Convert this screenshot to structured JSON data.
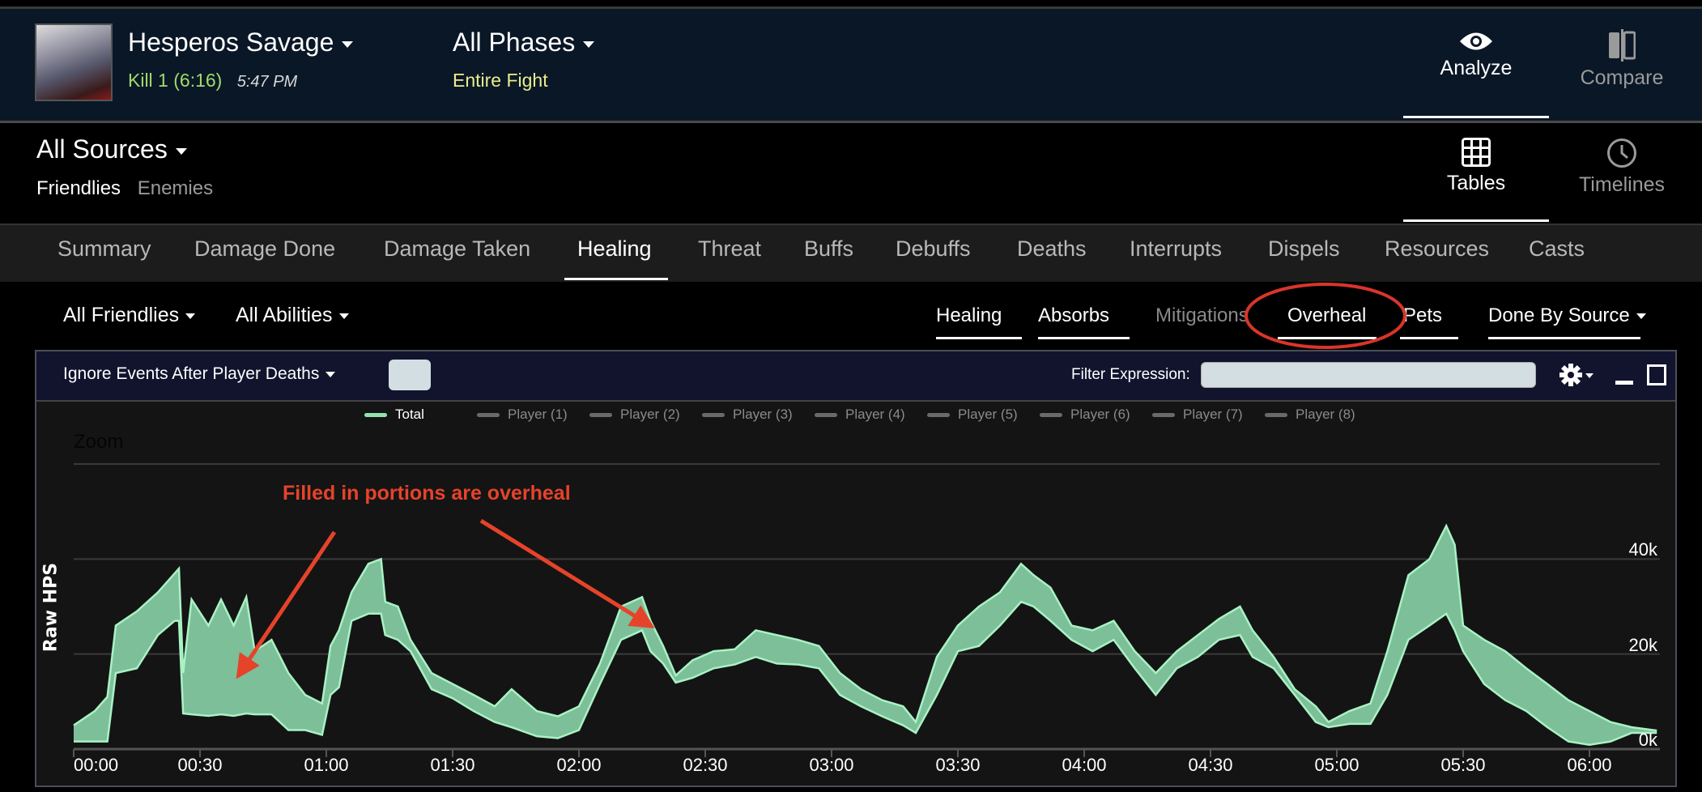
{
  "header": {
    "encounter_name": "Hesperos Savage",
    "kill_label": "Kill 1 (6:16)",
    "time": "5:47 PM",
    "phase_select": "All Phases",
    "phase_sub": "Entire Fight",
    "modes": [
      {
        "label": "Analyze",
        "icon": "eye-icon",
        "active": true
      },
      {
        "label": "Compare",
        "icon": "compare-icon",
        "active": false
      }
    ]
  },
  "sources": {
    "select": "All Sources",
    "filters": [
      "Friendlies",
      "Enemies"
    ],
    "views": [
      {
        "label": "Tables",
        "icon": "grid-icon",
        "active": true
      },
      {
        "label": "Timelines",
        "icon": "clock-icon",
        "active": false
      }
    ]
  },
  "tabs": [
    "Summary",
    "Damage Done",
    "Damage Taken",
    "Healing",
    "Threat",
    "Buffs",
    "Debuffs",
    "Deaths",
    "Interrupts",
    "Dispels",
    "Resources",
    "Casts"
  ],
  "active_tab": "Healing",
  "filters": {
    "friendlies": "All Friendlies",
    "abilities": "All Abilities",
    "subtabs": [
      "Healing",
      "Absorbs",
      "Mitigations",
      "Overheal",
      "Pets"
    ],
    "grouping": "Done By Source"
  },
  "panel": {
    "ignore_events": "Ignore Events After Player Deaths",
    "filter_label": "Filter Expression:",
    "filter_value": ""
  },
  "colors": {
    "accent_green": "#8fe3b0",
    "fill_green": "#7dbf98",
    "annotation_red": "#e5432a",
    "header_navy": "#0a1727"
  },
  "annotation": {
    "text": "Filled in portions are overheal"
  },
  "chart_data": {
    "type": "area",
    "zoom_label": "Zoom",
    "ylabel": "Raw HPS",
    "xlabel": "",
    "ylim": [
      0,
      60000
    ],
    "xlim": [
      "00:00",
      "06:16"
    ],
    "grid": true,
    "legend_position": "top",
    "legend": [
      "Total",
      "Player (1)",
      "Player (2)",
      "Player (3)",
      "Player (4)",
      "Player (5)",
      "Player (6)",
      "Player (7)",
      "Player (8)"
    ],
    "x_ticks": [
      "00:00",
      "00:30",
      "01:00",
      "01:30",
      "02:00",
      "02:30",
      "03:00",
      "03:30",
      "04:00",
      "04:30",
      "05:00",
      "05:30",
      "06:00"
    ],
    "y_ticks": [
      "0k",
      "20k",
      "40k"
    ],
    "x_seconds": [
      0,
      5,
      8,
      10,
      15,
      20,
      24,
      25,
      26,
      28,
      32,
      35,
      38,
      41,
      43,
      47,
      51,
      55,
      59,
      61,
      63,
      66,
      70,
      73,
      74,
      77,
      80,
      85,
      90,
      95,
      100,
      104,
      110,
      115,
      120,
      125,
      130,
      135,
      137,
      140,
      143,
      147,
      152,
      157,
      162,
      167,
      172,
      177,
      182,
      187,
      192,
      197,
      200,
      205,
      210,
      215,
      220,
      225,
      228,
      232,
      237,
      242,
      247,
      252,
      257,
      262,
      267,
      272,
      277,
      280,
      285,
      290,
      295,
      298,
      303,
      308,
      312,
      317,
      322,
      326,
      328,
      330,
      335,
      340,
      345,
      350,
      355,
      360,
      365,
      370,
      376
    ],
    "series": [
      {
        "name": "Total",
        "values": [
          5000,
          8000,
          11000,
          26000,
          29000,
          33000,
          37000,
          38000,
          16000,
          31500,
          26000,
          31500,
          26000,
          32000,
          20600,
          23000,
          16000,
          11400,
          9600,
          21700,
          25000,
          33000,
          39000,
          40000,
          31000,
          30000,
          23000,
          16000,
          13700,
          11400,
          9000,
          12600,
          8000,
          6900,
          9000,
          18000,
          30000,
          32000,
          27000,
          21700,
          15500,
          18700,
          20600,
          21000,
          25000,
          24000,
          23000,
          21700,
          16000,
          12600,
          10300,
          9000,
          5700,
          19400,
          26000,
          30000,
          33000,
          39000,
          36600,
          34000,
          26000,
          25000,
          27000,
          20600,
          16000,
          20600,
          24000,
          27400,
          30000,
          25000,
          19400,
          12600,
          9000,
          5700,
          8000,
          9600,
          20600,
          36600,
          40000,
          47000,
          43000,
          26000,
          23000,
          20600,
          17000,
          13700,
          10300,
          8000,
          5700,
          4600,
          3900
        ]
      },
      {
        "values": [
          1600,
          1600,
          1600,
          16000,
          17000,
          24000,
          27000,
          27000,
          7500,
          7300,
          7000,
          7300,
          7000,
          7500,
          7300,
          7300,
          4000,
          4000,
          3000,
          11400,
          13000,
          27000,
          28500,
          28500,
          24000,
          23000,
          20600,
          12600,
          10700,
          8000,
          5700,
          4600,
          2700,
          2300,
          4000,
          13700,
          23000,
          25000,
          20600,
          18000,
          14000,
          15000,
          17000,
          17800,
          19400,
          18000,
          17800,
          17000,
          11400,
          9000,
          6900,
          5000,
          3400,
          11400,
          20600,
          21700,
          26000,
          31000,
          30000,
          27000,
          23000,
          20600,
          23000,
          17000,
          11400,
          17000,
          19400,
          23000,
          24000,
          19400,
          17000,
          11400,
          5700,
          4600,
          5300,
          5300,
          11400,
          23000,
          26000,
          28500,
          25000,
          20600,
          13700,
          10300,
          8000,
          4600,
          1600,
          900,
          1600,
          3400,
          3400
        ]
      }
    ]
  }
}
